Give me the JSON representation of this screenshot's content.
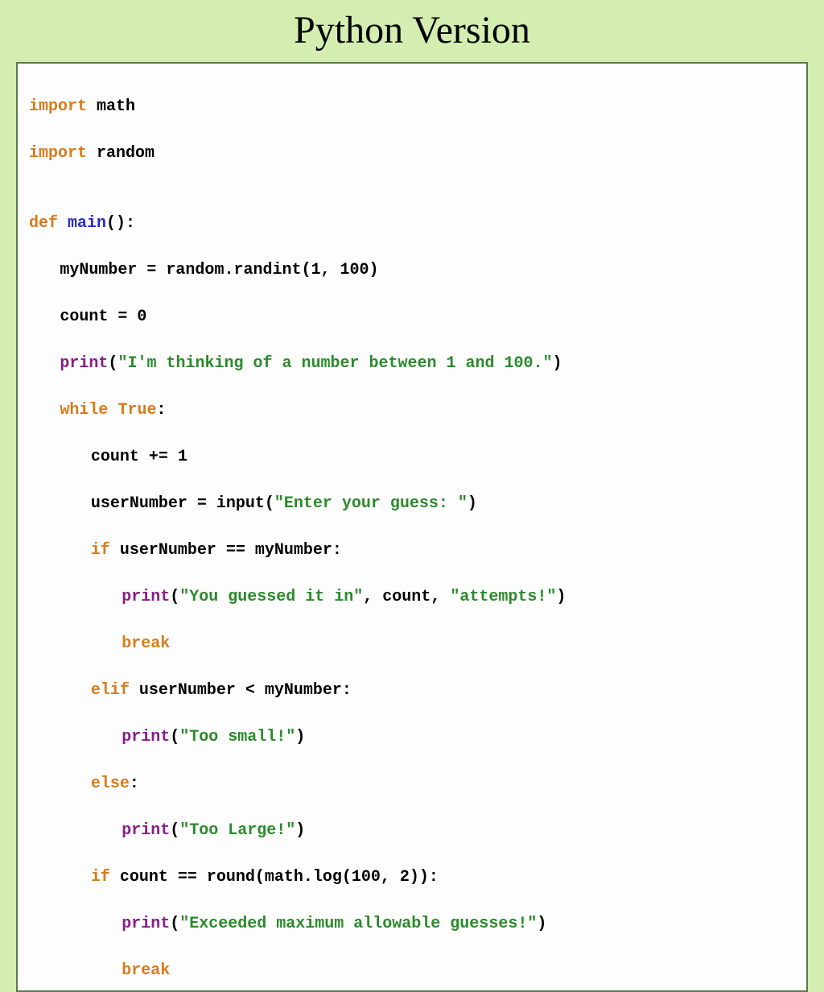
{
  "title": "Python Version",
  "code": {
    "l1a": "import",
    "l1b": " math",
    "l2a": "import",
    "l2b": " random",
    "l3": "",
    "l4a": "def",
    "l4b": " ",
    "l4c": "main",
    "l4d": "():",
    "l5": "myNumber = random.randint(1, 100)",
    "l6": "count = 0",
    "l7a": "print",
    "l7b": "(",
    "l7c": "\"I'm thinking of a number between 1 and 100.\"",
    "l7d": ")",
    "l8a": "while",
    "l8b": " ",
    "l8c": "True",
    "l8d": ":",
    "l9": "count += 1",
    "l10": "userNumber = input(",
    "l10b": "\"Enter your guess: \"",
    "l10c": ")",
    "l11a": "if",
    "l11b": " userNumber == myNumber:",
    "l12a": "print",
    "l12b": "(",
    "l12c": "\"You guessed it in\"",
    "l12d": ", count, ",
    "l12e": "\"attempts!\"",
    "l12f": ")",
    "l13": "break",
    "l14a": "elif",
    "l14b": " userNumber < myNumber:",
    "l15a": "print",
    "l15b": "(",
    "l15c": "\"Too small!\"",
    "l15d": ")",
    "l16a": "else",
    "l16b": ":",
    "l17a": "print",
    "l17b": "(",
    "l17c": "\"Too Large!\"",
    "l17d": ")",
    "l18a": "if",
    "l18b": " count == round(math.log(100, 2)):",
    "l19a": "print",
    "l19b": "(",
    "l19c": "\"Exceeded maximum allowable guesses!\"",
    "l19d": ")",
    "l20": "break"
  }
}
